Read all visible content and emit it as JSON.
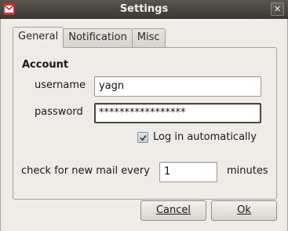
{
  "window": {
    "title": "Settings",
    "close_glyph": "✕"
  },
  "tabs": [
    {
      "label": "General",
      "mnemonic_index": 0,
      "active": true
    },
    {
      "label": "Notification",
      "mnemonic_index": 0,
      "active": false
    },
    {
      "label": "Misc",
      "mnemonic_index": 0,
      "active": false
    }
  ],
  "account": {
    "section_title": "Account",
    "username_label": "username",
    "username_value": "yagn",
    "password_label": "password",
    "password_value": "*****************",
    "auto_login_label": "Log in automatically",
    "auto_login_checked": true
  },
  "mail_check": {
    "label": "check for new mail every",
    "value": "1",
    "unit": "minutes"
  },
  "buttons": {
    "cancel_label": "Cancel",
    "ok_label": "Ok"
  },
  "icons": {
    "app": "gmail-icon",
    "close": "close-icon",
    "check": "checkmark-icon"
  },
  "colors": {
    "titlebar": "#3c3834",
    "app_icon": "#c8322e",
    "window_bg": "#efebe7"
  }
}
